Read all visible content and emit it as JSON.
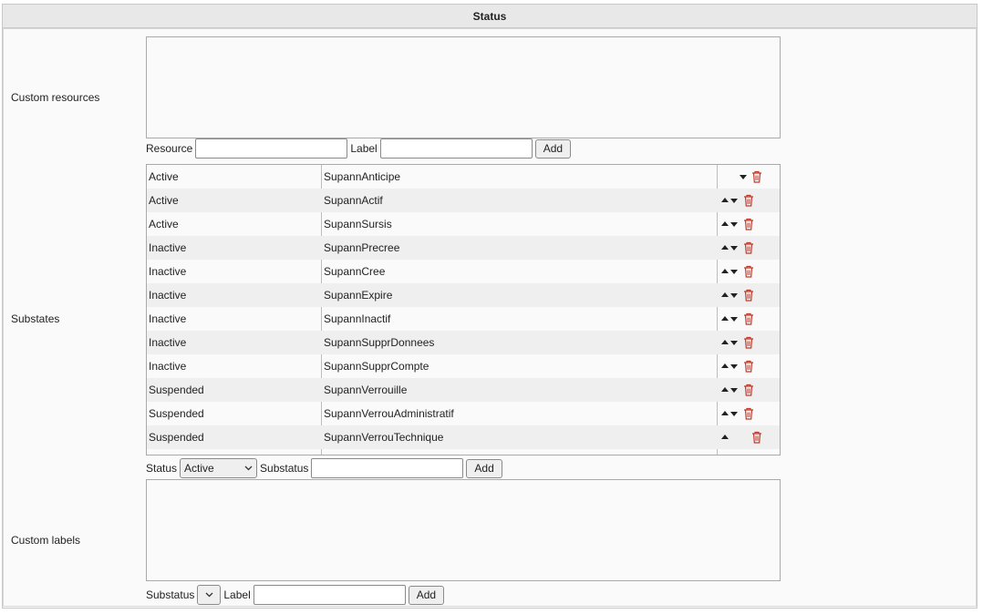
{
  "header": {
    "title": "Status"
  },
  "custom_resources": {
    "label": "Custom resources",
    "resource_label": "Resource",
    "resource_value": "",
    "label_label": "Label",
    "label_value": "",
    "add_label": "Add"
  },
  "substates": {
    "label": "Substates",
    "rows": [
      {
        "status": "Active",
        "substatus": "SupannAnticipe"
      },
      {
        "status": "Active",
        "substatus": "SupannActif"
      },
      {
        "status": "Active",
        "substatus": "SupannSursis"
      },
      {
        "status": "Inactive",
        "substatus": "SupannPrecree"
      },
      {
        "status": "Inactive",
        "substatus": "SupannCree"
      },
      {
        "status": "Inactive",
        "substatus": "SupannExpire"
      },
      {
        "status": "Inactive",
        "substatus": "SupannInactif"
      },
      {
        "status": "Inactive",
        "substatus": "SupannSupprDonnees"
      },
      {
        "status": "Inactive",
        "substatus": "SupannSupprCompte"
      },
      {
        "status": "Suspended",
        "substatus": "SupannVerrouille"
      },
      {
        "status": "Suspended",
        "substatus": "SupannVerrouAdministratif"
      },
      {
        "status": "Suspended",
        "substatus": "SupannVerrouTechnique"
      }
    ],
    "status_label": "Status",
    "status_selected": "Active",
    "substatus_label": "Substatus",
    "substatus_value": "",
    "add_label": "Add"
  },
  "custom_labels": {
    "label": "Custom labels",
    "substatus_label": "Substatus",
    "substatus_selected": "",
    "label_label": "Label",
    "label_value": "",
    "add_label": "Add"
  },
  "icons": {
    "move_up": "arrow-up-icon",
    "move_down": "arrow-down-icon",
    "delete": "trash-icon"
  },
  "colors": {
    "trash": "#c0392b"
  }
}
